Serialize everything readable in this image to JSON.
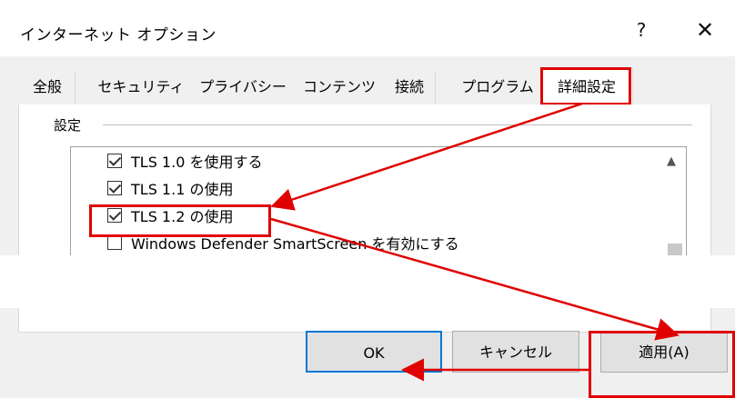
{
  "window": {
    "title": "インターネット オプション",
    "help_glyph": "?",
    "close_glyph": "✕"
  },
  "tabs": [
    {
      "label": "全般"
    },
    {
      "label": "セキュリティ"
    },
    {
      "label": "プライバシー"
    },
    {
      "label": "コンテンツ"
    },
    {
      "label": "接続"
    },
    {
      "label": "プログラム"
    },
    {
      "label": "詳細設定",
      "active": true
    }
  ],
  "settings": {
    "group_label": "設定",
    "items": [
      {
        "label": "TLS 1.0 を使用する",
        "checked": true
      },
      {
        "label": "TLS 1.1 の使用",
        "checked": true
      },
      {
        "label": "TLS 1.2 の使用",
        "checked": true
      },
      {
        "label": "Windows Defender SmartScreen を有効にする",
        "checked": false
      }
    ]
  },
  "buttons": {
    "ok": "OK",
    "cancel": "キャンセル",
    "apply": "適用(A)"
  },
  "colors": {
    "annotation": "#e00000",
    "ok_border": "#0078d7"
  }
}
